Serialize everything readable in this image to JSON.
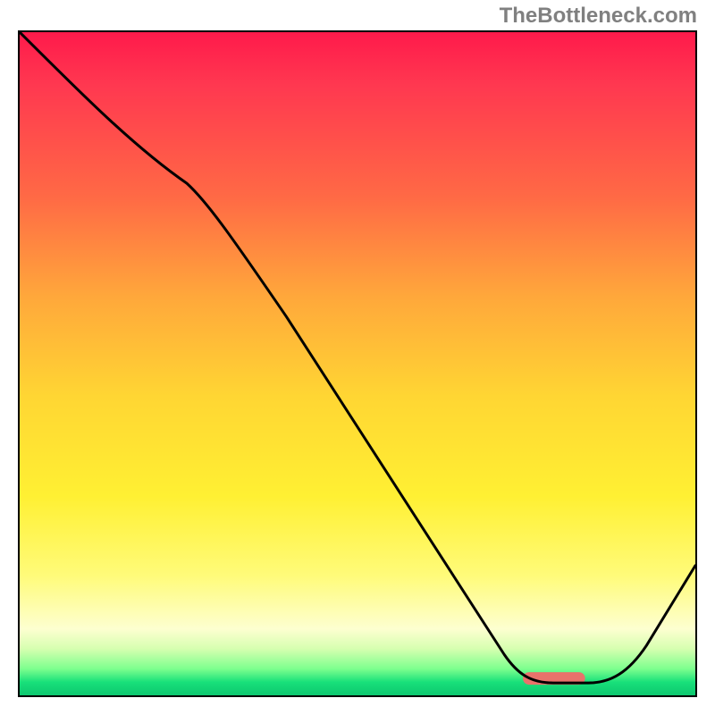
{
  "watermark": "TheBottleneck.com",
  "chart_data": {
    "type": "line",
    "title": "",
    "xlabel": "",
    "ylabel": "",
    "xlim": [
      0,
      100
    ],
    "ylim": [
      0,
      100
    ],
    "grid": false,
    "legend": false,
    "series": [
      {
        "name": "bottleneck-curve",
        "x": [
          0,
          25,
          80,
          85,
          100
        ],
        "values": [
          100,
          78,
          1.5,
          1.5,
          22
        ],
        "comment": "percentage-style curve: steep drop from top-left, shallow valley floor around x≈80–85, then rises toward right edge"
      }
    ],
    "marker": {
      "name": "optimum-region",
      "shape": "rounded-bar",
      "x_start": 79,
      "x_end": 86,
      "y": 1.5,
      "color": "#e8726b"
    },
    "background_gradient": {
      "direction": "vertical",
      "stops": [
        {
          "pos": 0,
          "color": "#ff1a4b"
        },
        {
          "pos": 25,
          "color": "#ff6a45"
        },
        {
          "pos": 55,
          "color": "#ffd633"
        },
        {
          "pos": 82,
          "color": "#fffb7a"
        },
        {
          "pos": 96,
          "color": "#7dff8e"
        },
        {
          "pos": 100,
          "color": "#0dc76f"
        }
      ]
    }
  }
}
